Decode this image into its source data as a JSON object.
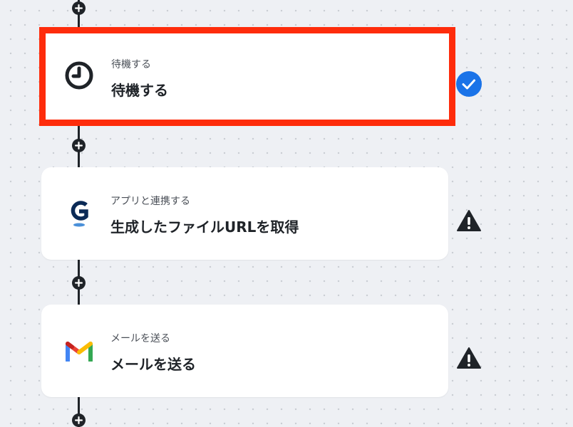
{
  "colors": {
    "selected_border": "#fe2c0b",
    "success": "#1a73e8",
    "connector": "#1f2328"
  },
  "steps": [
    {
      "category": "待機する",
      "title": "待機する",
      "icon": "clock-icon",
      "status": "success",
      "status_icon": "check-circle-icon",
      "selected": true
    },
    {
      "category": "アプリと連携する",
      "title": "生成したファイルURLを取得",
      "icon": "g-app-logo-icon",
      "status": "warning",
      "status_icon": "warning-triangle-icon",
      "selected": false
    },
    {
      "category": "メールを送る",
      "title": "メールを送る",
      "icon": "gmail-icon",
      "status": "warning",
      "status_icon": "warning-triangle-icon",
      "selected": false
    }
  ],
  "add_step_icon": "plus-icon"
}
